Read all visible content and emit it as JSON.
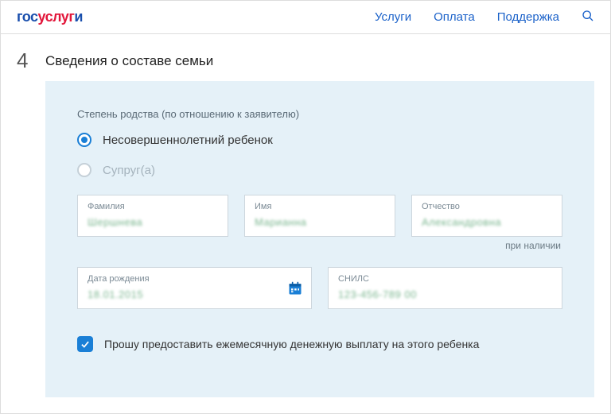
{
  "header": {
    "logo": {
      "part1": "гос",
      "part2": "услуг",
      "part3": "и"
    },
    "nav": {
      "services": "Услуги",
      "payment": "Оплата",
      "support": "Поддержка"
    }
  },
  "step": {
    "number": "4",
    "title": "Сведения о составе семьи"
  },
  "form": {
    "relationship_caption": "Степень родства (по отношению к заявителю)",
    "radio": {
      "minor_child": "Несовершеннолетний ребенок",
      "spouse": "Супруг(а)"
    },
    "fields": {
      "surname": {
        "label": "Фамилия",
        "value": "Шершнева"
      },
      "name": {
        "label": "Имя",
        "value": "Марианна"
      },
      "patronymic": {
        "label": "Отчество",
        "value": "Александровна"
      },
      "patronymic_helper": "при наличии",
      "birthdate": {
        "label": "Дата рождения",
        "value": "18.01.2015"
      },
      "snils": {
        "label": "СНИЛС",
        "value": "123-456-789 00"
      }
    },
    "checkbox_label": "Прошу предоставить ежемесячную денежную выплату на этого ребенка"
  }
}
